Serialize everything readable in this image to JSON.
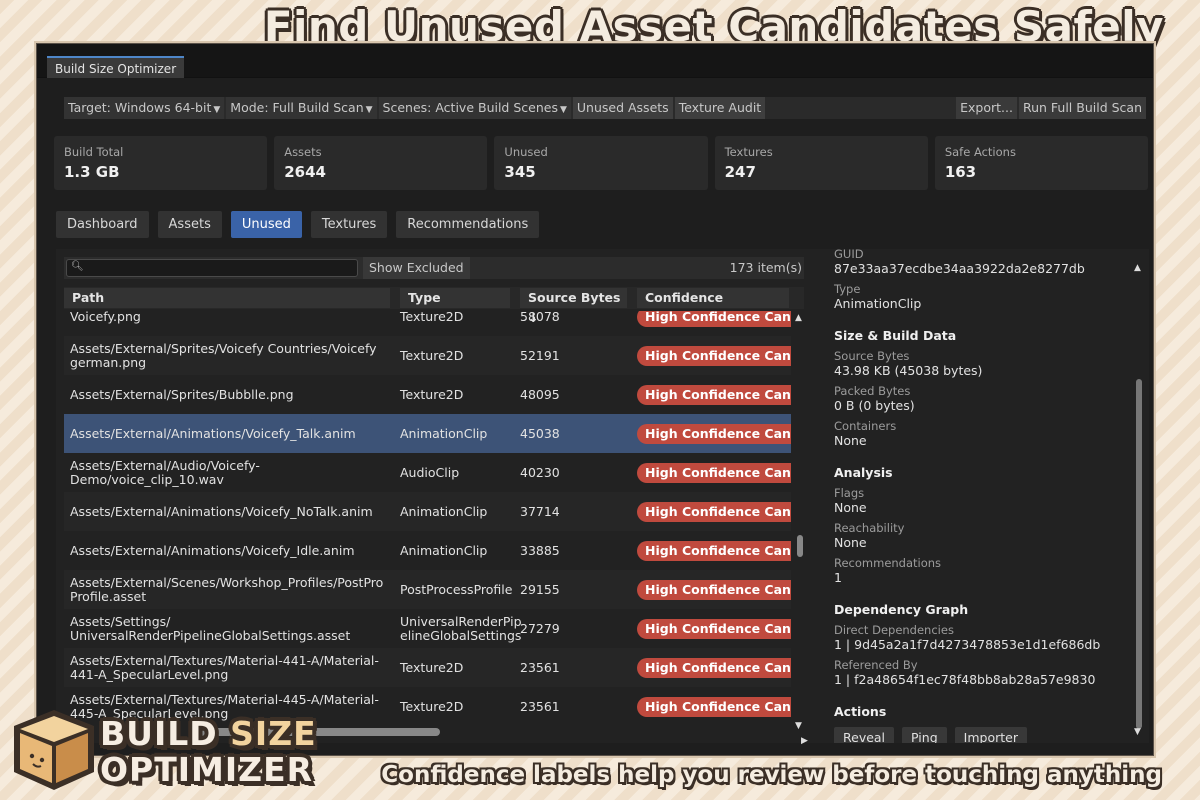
{
  "headline": "Find Unused Asset Candidates Safely",
  "caption": "Confidence labels help you review before touching anything",
  "logo": {
    "line1_a": "BUILD",
    "line1_b": "SIZE",
    "line2": "OPTIMIZER"
  },
  "window": {
    "tab_title": "Build Size Optimizer"
  },
  "toolbar": {
    "target": "Target: Windows 64-bit",
    "mode": "Mode: Full Build Scan",
    "scenes": "Scenes: Active Build Scenes",
    "unused_assets": "Unused Assets",
    "texture_audit": "Texture Audit",
    "export": "Export...",
    "run_scan": "Run Full Build Scan"
  },
  "stats": [
    {
      "label": "Build Total",
      "value": "1.3 GB"
    },
    {
      "label": "Assets",
      "value": "2644"
    },
    {
      "label": "Unused",
      "value": "345"
    },
    {
      "label": "Textures",
      "value": "247"
    },
    {
      "label": "Safe Actions",
      "value": "163"
    }
  ],
  "nav_tabs": [
    "Dashboard",
    "Assets",
    "Unused",
    "Textures",
    "Recommendations"
  ],
  "active_nav_tab": "Unused",
  "filter": {
    "search_value": "",
    "show_excluded": "Show Excluded",
    "count": "173 item(s)"
  },
  "columns": [
    "Path",
    "Type",
    "Source Bytes ↓",
    "Confidence"
  ],
  "rows": [
    {
      "path": "Voicefy.png",
      "type": "Texture2D",
      "bytes": "58078",
      "confidence": "High Confidence Candidate"
    },
    {
      "path": "Assets/External/Sprites/Voicefy Countries/Voicefy german.png",
      "type": "Texture2D",
      "bytes": "52191",
      "confidence": "High Confidence Candidate"
    },
    {
      "path": "Assets/External/Sprites/Bubblle.png",
      "type": "Texture2D",
      "bytes": "48095",
      "confidence": "High Confidence Candidate"
    },
    {
      "path": "Assets/External/Animations/Voicefy_Talk.anim",
      "type": "AnimationClip",
      "bytes": "45038",
      "confidence": "High Confidence Candidate"
    },
    {
      "path": "Assets/External/Audio/Voicefy-Demo/voice_clip_10.wav",
      "type": "AudioClip",
      "bytes": "40230",
      "confidence": "High Confidence Candidate"
    },
    {
      "path": "Assets/External/Animations/Voicefy_NoTalk.anim",
      "type": "AnimationClip",
      "bytes": "37714",
      "confidence": "High Confidence Candidate"
    },
    {
      "path": "Assets/External/Animations/Voicefy_Idle.anim",
      "type": "AnimationClip",
      "bytes": "33885",
      "confidence": "High Confidence Candidate"
    },
    {
      "path": "Assets/External/Scenes/Workshop_Profiles/PostPro Profile.asset",
      "type": "PostProcessProfile",
      "bytes": "29155",
      "confidence": "High Confidence Candidate"
    },
    {
      "path": "Assets/Settings/ UniversalRenderPipelineGlobalSettings.asset",
      "type": "UniversalRenderPip elineGlobalSettings",
      "bytes": "27279",
      "confidence": "High Confidence Candidate"
    },
    {
      "path": "Assets/External/Textures/Material-441-A/Material-441-A_SpecularLevel.png",
      "type": "Texture2D",
      "bytes": "23561",
      "confidence": "High Confidence Candidate"
    },
    {
      "path": "Assets/External/Textures/Material-445-A/Material-445-A_SpecularLevel.png",
      "type": "Texture2D",
      "bytes": "23561",
      "confidence": "High Confidence Candidate"
    }
  ],
  "selected_row": 3,
  "details": {
    "guid_label": "GUID",
    "guid": "87e33aa37ecdbe34aa3922da2e8277db",
    "type_label": "Type",
    "type": "AnimationClip",
    "size_head": "Size & Build Data",
    "source_bytes_label": "Source Bytes",
    "source_bytes": "43.98 KB (45038 bytes)",
    "packed_bytes_label": "Packed Bytes",
    "packed_bytes": "0 B (0 bytes)",
    "containers_label": "Containers",
    "containers": "None",
    "analysis_head": "Analysis",
    "flags_label": "Flags",
    "flags": "None",
    "reach_label": "Reachability",
    "reach": "None",
    "recs_label": "Recommendations",
    "recs": "1",
    "graph_head": "Dependency Graph",
    "direct_label": "Direct Dependencies",
    "direct": "1 | 9d45a2a1f7d4273478853e1d1ef686db",
    "refby_label": "Referenced By",
    "refby": "1 | f2a48654f1ec78f48bb8ab28a57e9830",
    "actions_head": "Actions",
    "actions": [
      "Reveal",
      "Ping",
      "Importer"
    ]
  },
  "colors": {
    "accent": "#3a63a8",
    "badge": "#c04a3e",
    "selected_row": "#3d5377",
    "background": "#f3e6d4"
  },
  "icons": {
    "search": "search-icon",
    "sort": "sort-down-icon"
  }
}
